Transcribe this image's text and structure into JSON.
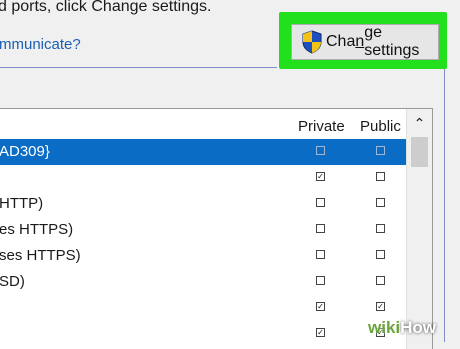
{
  "intro_text": "d ports, click Change settings.",
  "help_link": "mmunicate?",
  "change_button": {
    "prefix": "Cha",
    "underlined": "n",
    "suffix": "ge settings",
    "icon": "uac-shield-icon"
  },
  "table": {
    "columns": {
      "private": "Private",
      "public": "Public"
    },
    "rows": [
      {
        "name": "AD309}",
        "private": false,
        "public": false,
        "selected": true
      },
      {
        "name": "",
        "private": true,
        "public": false,
        "selected": false
      },
      {
        "name": "HTTP)",
        "private": false,
        "public": false,
        "selected": false
      },
      {
        "name": "es HTTPS)",
        "private": false,
        "public": false,
        "selected": false
      },
      {
        "name": "ses HTTPS)",
        "private": false,
        "public": false,
        "selected": false
      },
      {
        "name": "SD)",
        "private": false,
        "public": false,
        "selected": false
      },
      {
        "name": "",
        "private": true,
        "public": true,
        "selected": false
      },
      {
        "name": "",
        "private": true,
        "public": true,
        "selected": false
      }
    ]
  },
  "scrollbar": {
    "up_arrow": "⌃"
  },
  "watermark": {
    "part1": "wiki",
    "part2": "How"
  },
  "colors": {
    "highlight": "#22e01e",
    "selection": "#0a6cc4",
    "link": "#1a5fb4"
  }
}
